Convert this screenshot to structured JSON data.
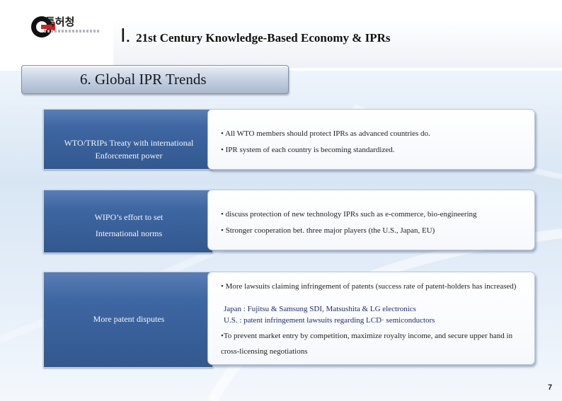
{
  "header": {
    "logo_text": "특허청",
    "numeral": "Ⅰ.",
    "title": "21st Century Knowledge-Based Economy & IPRs"
  },
  "section": {
    "title": "6. Global IPR Trends"
  },
  "rows": [
    {
      "label_lines": [
        "WTO/TRIPs Treaty with international",
        "Enforcement power"
      ],
      "bullets": [
        "• All WTO members should protect IPRs as advanced countries do.",
        "• IPR system of each country is becoming standardized."
      ]
    },
    {
      "label_lines": [
        "WIPO’s effort to set",
        "International norms"
      ],
      "bullets": [
        "• discuss protection of new technology IPRs such as e-commerce, bio-engineering",
        "• Stronger cooperation bet. three major players (the U.S., Japan, EU)"
      ]
    },
    {
      "label_lines": [
        "More patent disputes"
      ],
      "bullet_main_1": "• More lawsuits claiming infringement of patents (success rate of patent-holders has increased)",
      "sub_1": "Japan : Fujitsu & Samsung SDI, Matsushita & LG electronics",
      "sub_2": "U.S. : patent infringement lawsuits regarding LCD· semiconductors",
      "bullet_main_2": "•To prevent market entry by competition, maximize royalty income, and secure upper hand in cross-licensing negotiations"
    }
  ],
  "page_number": "7",
  "colors": {
    "accent": "#3e66a2",
    "subtext": "#1f2b6b"
  }
}
